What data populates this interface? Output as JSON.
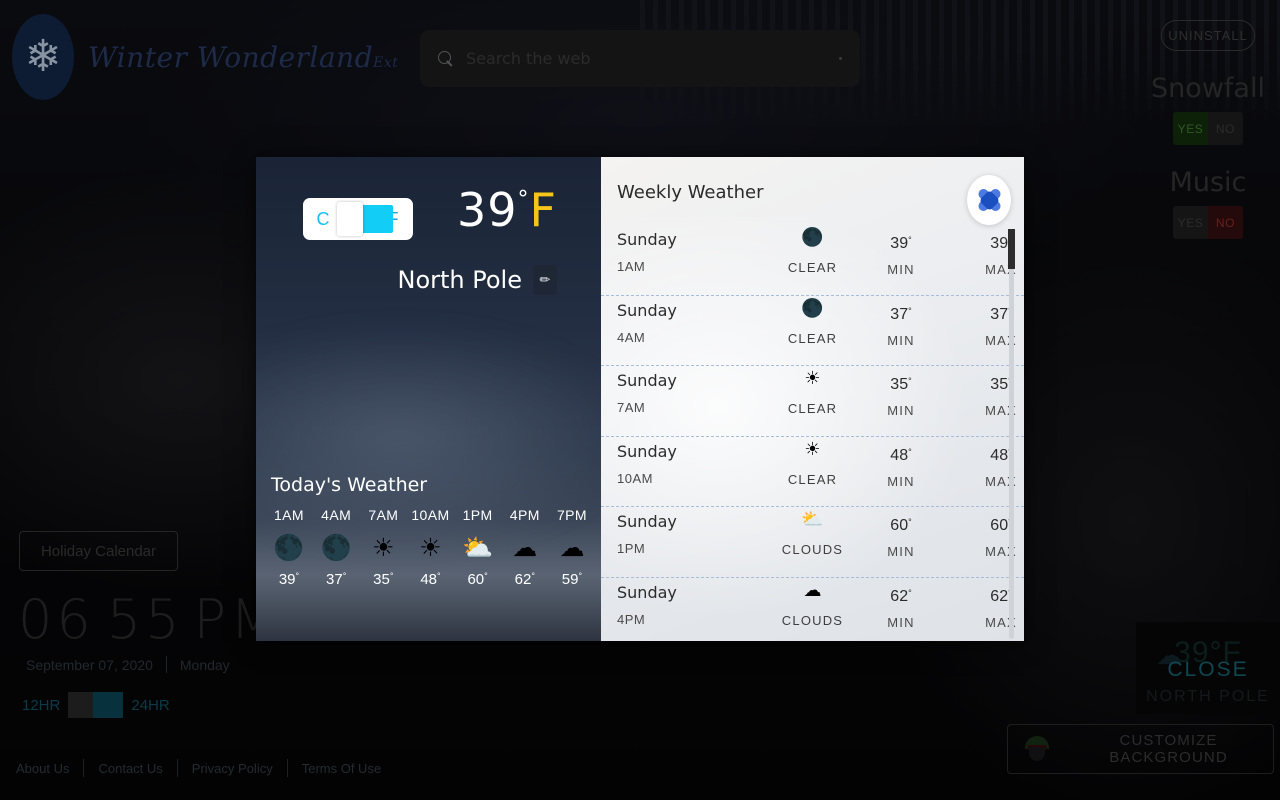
{
  "brand": {
    "name": "Winter Wonderland",
    "sup": "Ext",
    "icon": "snowflake-icon"
  },
  "search": {
    "placeholder": "Search the web",
    "icon": "search-icon"
  },
  "rail": {
    "uninstall_label": "UNINSTALL",
    "snowfall_label": "Snowfall",
    "snowfall_yes": "YES",
    "snowfall_no": "NO",
    "music_label": "Music",
    "music_yes": "YES",
    "music_no": "NO"
  },
  "left": {
    "holiday_button": "Holiday Calendar",
    "clock_hours": "06",
    "clock_minutes": "55",
    "clock_ampm": "PM",
    "date": "September 07, 2020",
    "weekday": "Monday",
    "hr12_label": "12HR",
    "hr24_label": "24HR",
    "footer": [
      {
        "label": "About Us"
      },
      {
        "label": "Contact Us"
      },
      {
        "label": "Privacy Policy"
      },
      {
        "label": "Terms Of Use"
      }
    ]
  },
  "mini_widget": {
    "temp": "39°F",
    "location": "NORTH POLE",
    "close_label": "CLOSE",
    "cloud_icon": "☁",
    "customize_label": "CUSTOMIZE BACKGROUND",
    "santa_icon": "santa-icon"
  },
  "modal": {
    "unit_toggle": {
      "c": "C",
      "f": "F",
      "selected": "F"
    },
    "current_temp": "39",
    "current_degree": "°",
    "current_unit": "F",
    "location": "North Pole",
    "edit_icon": "✏",
    "today_title": "Today's Weather",
    "weekly_title": "Weekly Weather",
    "close_icon": "close-icon",
    "hourly": [
      {
        "time": "1AM",
        "icon": "🌑",
        "temp": "39"
      },
      {
        "time": "4AM",
        "icon": "🌑",
        "temp": "37"
      },
      {
        "time": "7AM",
        "icon": "☀",
        "temp": "35"
      },
      {
        "time": "10AM",
        "icon": "☀",
        "temp": "48"
      },
      {
        "time": "1PM",
        "icon": "⛅",
        "temp": "60"
      },
      {
        "time": "4PM",
        "icon": "☁",
        "temp": "62"
      },
      {
        "time": "7PM",
        "icon": "☁",
        "temp": "59"
      }
    ],
    "min_label": "MIN",
    "max_label": "MAX",
    "degree_mark": "°",
    "weekly": [
      {
        "day": "Sunday",
        "time": "1AM",
        "icon": "🌑",
        "condition": "CLEAR",
        "min": "39",
        "max": "39"
      },
      {
        "day": "Sunday",
        "time": "4AM",
        "icon": "🌑",
        "condition": "CLEAR",
        "min": "37",
        "max": "37"
      },
      {
        "day": "Sunday",
        "time": "7AM",
        "icon": "☀",
        "condition": "CLEAR",
        "min": "35",
        "max": "35"
      },
      {
        "day": "Sunday",
        "time": "10AM",
        "icon": "☀",
        "condition": "CLEAR",
        "min": "48",
        "max": "48"
      },
      {
        "day": "Sunday",
        "time": "1PM",
        "icon": "⛅",
        "condition": "CLOUDS",
        "min": "60",
        "max": "60"
      },
      {
        "day": "Sunday",
        "time": "4PM",
        "icon": "☁",
        "condition": "CLOUDS",
        "min": "62",
        "max": "62"
      }
    ]
  },
  "colors": {
    "accent_cyan": "#12cdf5",
    "accent_yellow": "#f5c518",
    "close_blue": "#1b4fc0",
    "yes_green": "#2e5a22",
    "no_red": "#6d1f1f"
  }
}
